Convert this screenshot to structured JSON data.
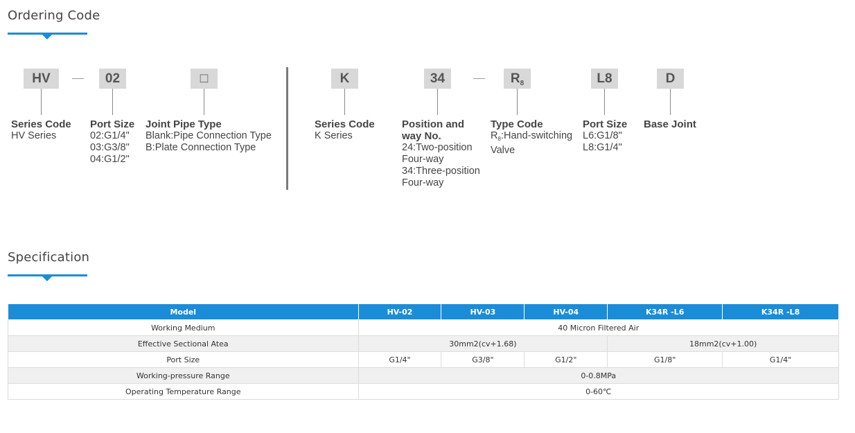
{
  "ordering": {
    "title": "Ordering Code",
    "boxes": {
      "hv": "HV",
      "port": "02",
      "joint": "□",
      "k": "K",
      "pos": "34",
      "type_main": "R",
      "type_sub": "8",
      "l8": "L8",
      "d": "D"
    },
    "labels": {
      "series_hv": {
        "head": "Series Code",
        "lines": [
          "HV Series"
        ]
      },
      "port_size_hv": {
        "head": "Port Size",
        "lines": [
          "02:G1/4\"",
          "03:G3/8\"",
          "04:G1/2\""
        ]
      },
      "joint_pipe": {
        "head": "Joint Pipe Type",
        "lines": [
          "Blank:Pipe Connection Type",
          "B:Plate Connection Type"
        ]
      },
      "series_k": {
        "head": "Series Code",
        "lines": [
          "K Series"
        ]
      },
      "position": {
        "head_line1": "Position and",
        "head_line2": "way No.",
        "lines": [
          "24:Two-position",
          "Four-way",
          "34:Three-position",
          "Four-way"
        ]
      },
      "type_code": {
        "head": "Type Code",
        "line1_main": "R",
        "line1_sub": "8",
        "line1_rest": ":Hand-switching",
        "line2": "Valve"
      },
      "port_size_k": {
        "head": "Port Size",
        "lines": [
          "L6:G1/8\"",
          "L8:G1/4\""
        ]
      },
      "base_joint": {
        "head": "Base Joint"
      }
    }
  },
  "specification": {
    "title": "Specification",
    "headers": [
      "Model",
      "HV-02",
      "HV-03",
      "HV-04",
      "K34R -L6",
      "K34R -L8"
    ],
    "rows": {
      "working_medium": {
        "label": "Working Medium",
        "value": "40 Micron Filtered Air"
      },
      "effective_area": {
        "label": "Effective Sectional Atea",
        "hv": "30mm2(cv+1.68)",
        "k": "18mm2(cv+1.00)"
      },
      "port_size": {
        "label": "Port Size",
        "values": [
          "G1/4\"",
          "G3/8\"",
          "G1/2\"",
          "G1/8\"",
          "G1/4\""
        ]
      },
      "pressure": {
        "label": "Working-pressure Range",
        "value": "0-0.8MPa"
      },
      "temperature": {
        "label": "Operating Temperature Range",
        "value": "0-60℃"
      }
    }
  }
}
